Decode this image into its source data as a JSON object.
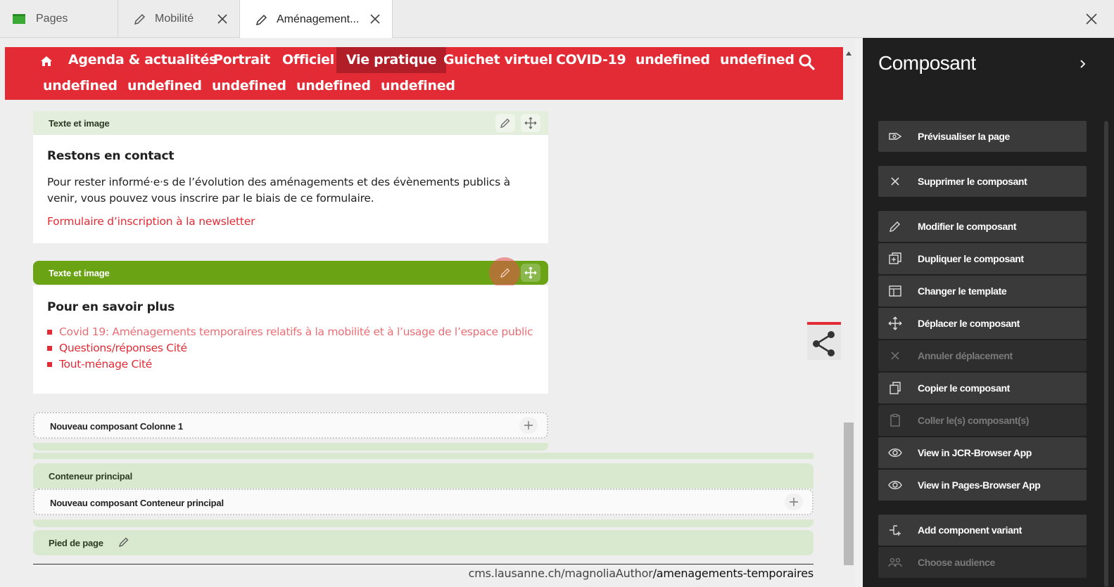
{
  "tabs": [
    {
      "label": "Pages",
      "icon": "pages-icon"
    },
    {
      "label": "Mobilité",
      "icon": "pencil-icon"
    },
    {
      "label": "Aménagement...",
      "icon": "pencil-icon"
    }
  ],
  "nav": {
    "row1": [
      "Agenda & actualités",
      "Portrait",
      "Officiel",
      "Vie pratique",
      "Guichet virtuel",
      "COVID-19",
      "undefined",
      "undefined"
    ],
    "row2": [
      "undefined",
      "undefined",
      "undefined",
      "undefined",
      "undefined"
    ],
    "active": "Vie pratique"
  },
  "blocks": {
    "block1": {
      "bar_label": "Texte et image",
      "heading": "Restons en contact",
      "paragraph": "Pour rester informé·e·s de l’évolution des aménagements et des évènements publics à venir, vous pouvez vous inscrire par le biais de ce formulaire.",
      "link": "Formulaire d’inscription à la newsletter"
    },
    "block2": {
      "bar_label": "Texte et image",
      "heading": "Pour en savoir plus",
      "links": [
        "Covid 19: Aménagements temporaires relatifs à la mobilité et à l’usage de l’espace public",
        "Questions/réponses Cité",
        "Tout-ménage Cité"
      ]
    }
  },
  "new_component_col1": "Nouveau composant Colonne 1",
  "main_container": "Conteneur principal",
  "new_component_main": "Nouveau composant Conteneur principal",
  "footer_area": "Pied de page",
  "url": {
    "prefix": "cms.lausanne.ch/magnoliaAuthor",
    "path": "/amenagements-temporaires"
  },
  "panel": {
    "title": "Composant",
    "actions": [
      {
        "label": "Prévisualiser la page",
        "icon": "preview-icon",
        "enabled": true
      },
      {
        "label": "Supprimer le composant",
        "icon": "delete-icon",
        "enabled": true
      },
      {
        "label": "Modifier le composant",
        "icon": "edit-icon",
        "enabled": true
      },
      {
        "label": "Dupliquer le composant",
        "icon": "duplicate-icon",
        "enabled": true
      },
      {
        "label": "Changer le template",
        "icon": "template-icon",
        "enabled": true
      },
      {
        "label": "Déplacer le composant",
        "icon": "move-icon",
        "enabled": true
      },
      {
        "label": "Annuler déplacement",
        "icon": "cancel-move-icon",
        "enabled": false
      },
      {
        "label": "Copier le composant",
        "icon": "copy-icon",
        "enabled": true
      },
      {
        "label": "Coller le(s) composant(s)",
        "icon": "paste-icon",
        "enabled": false
      },
      {
        "label": "View in JCR-Browser App",
        "icon": "eye-icon",
        "enabled": true
      },
      {
        "label": "View in Pages-Browser App",
        "icon": "eye-icon",
        "enabled": true
      },
      {
        "label": "Add component variant",
        "icon": "variant-icon",
        "enabled": true
      },
      {
        "label": "Choose audience",
        "icon": "audience-icon",
        "enabled": false
      }
    ]
  },
  "colors": {
    "brand_red": "#e32b35",
    "active_green": "#6aa314",
    "panel_bg": "#1f1f1f"
  }
}
